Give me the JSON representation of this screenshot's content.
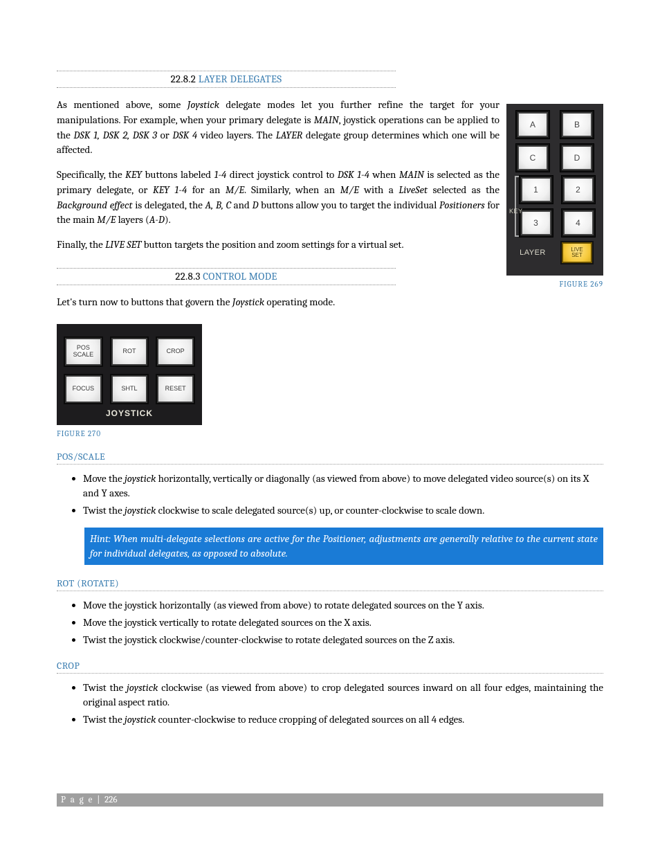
{
  "sections": {
    "s1": {
      "num": "22.8.2",
      "title": "LAYER DELEGATES"
    },
    "s2": {
      "num": "22.8.3",
      "title": "CONTROL MODE"
    }
  },
  "para": {
    "p1a": "As mentioned above, some ",
    "p1b": "Joystick",
    "p1c": " delegate modes let you further refine the target for your manipulations.  For example, when your primary delegate is ",
    "p1d": "MAIN",
    "p1e": ", joystick operations can be applied to the ",
    "p1f": "DSK 1, DSK 2, DSK 3",
    "p1g": " or ",
    "p1h": "DSK 4",
    "p1i": " video layers. The ",
    "p1j": "LAYER",
    "p1k": " delegate group determines which one will be affected.",
    "p2a": "Specifically, the ",
    "p2b": "KEY",
    "p2c": " buttons labeled ",
    "p2d": "1-4",
    "p2e": " direct joystick control to ",
    "p2f": "DSK 1-4",
    "p2g": " when ",
    "p2h": "MAIN",
    "p2i": " is selected as the primary delegate, or ",
    "p2j": "KEY 1-4",
    "p2k": " for an ",
    "p2l": "M/E",
    "p2m": ". Similarly, when an ",
    "p2n": "M/E",
    "p2o": " with a ",
    "p2p": "LiveSet",
    "p2q": " selected as the ",
    "p2r": "Background effect",
    "p2s": " is delegated, the ",
    "p2t": "A, B, C",
    "p2u": " and ",
    "p2v": "D",
    "p2w": " buttons allow you to target the individual ",
    "p2x": "Positioners",
    "p2y": " for the main ",
    "p2z": "M/E",
    "p2za": " layers (",
    "p2zb": "A-D",
    "p2zc": ").",
    "p3a": "Finally, the ",
    "p3b": "LIVE SET",
    "p3c": " button targets the position and zoom settings for a virtual set.",
    "p4a": "Let's turn now to buttons that govern the ",
    "p4b": "Joystick",
    "p4c": " operating mode."
  },
  "fig269": {
    "caption": "FIGURE 269",
    "buttons": {
      "a": "A",
      "b": "B",
      "c": "C",
      "d": "D",
      "k1": "1",
      "k2": "2",
      "k3": "3",
      "k4": "4"
    },
    "key_label": "KEY",
    "layer_label": "LAYER",
    "liveset_l1": "LIVE",
    "liveset_l2": "SET"
  },
  "fig270": {
    "caption": "FIGURE 270",
    "buttons": {
      "pos_scale": "POS\nSCALE",
      "rot": "ROT",
      "crop": "CROP",
      "focus": "FOCUS",
      "shtl": "SHTL",
      "reset": "RESET"
    },
    "label": "JOYSTICK"
  },
  "sub": {
    "pos_scale": "POS/SCALE",
    "rot_a": "ROT (R",
    "rot_b": "OTATE",
    "rot_c": ")",
    "crop": "CROP"
  },
  "bullets": {
    "ps1a": "Move the ",
    "ps1b": "joystick",
    "ps1c": " horizontally, vertically or diagonally (as viewed from above) to move delegated video source(s) on its X and Y axes.",
    "ps2a": "Twist the ",
    "ps2b": "joystick",
    "ps2c": " clockwise to scale delegated source(s) up, or counter-clockwise to scale down.",
    "rt1": "Move the joystick horizontally (as viewed from above) to rotate delegated sources on the Y axis.",
    "rt2": " Move the joystick vertically to rotate delegated sources on the X axis.",
    "rt3": "Twist the joystick clockwise/counter-clockwise to rotate delegated sources on the Z axis.",
    "cr1a": "Twist the ",
    "cr1b": "joystick",
    "cr1c": " clockwise (as viewed from above) to crop delegated sources inward on all four edges, maintaining the original aspect ratio.",
    "cr2a": "Twist the ",
    "cr2b": "joystick",
    "cr2c": " counter-clockwise to reduce cropping of delegated sources on all 4 edges."
  },
  "hint": "Hint: When multi-delegate selections are active for the Positioner, adjustments are generally relative to the current state for individual delegates, as opposed to absolute.",
  "footer": {
    "label": "P a g e",
    "sep": " | ",
    "num": "226"
  }
}
